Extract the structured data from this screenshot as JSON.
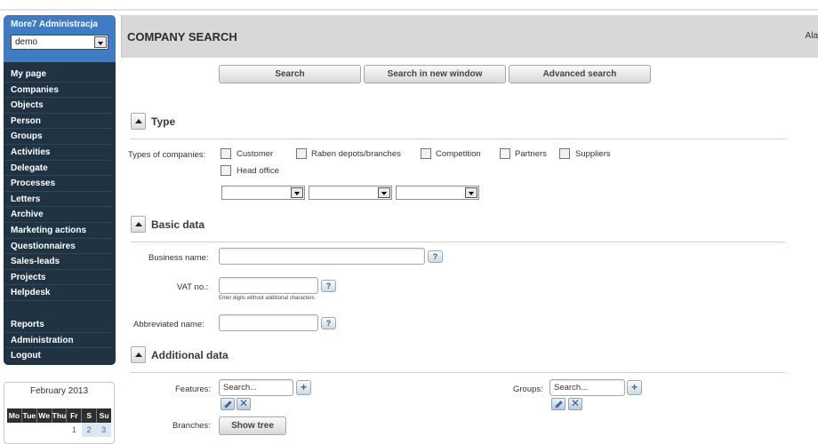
{
  "sidebar": {
    "brand_title": "More7 Administracja",
    "account_select": "demo",
    "menu": [
      "My page",
      "Companies",
      "Objects",
      "Person",
      "Groups",
      "Activities",
      "Delegate",
      "Processes",
      "Letters",
      "Archive",
      "Marketing actions",
      "Questionnaires",
      "Sales-leads",
      "Projects",
      "Helpdesk"
    ],
    "menu_bottom": [
      "Reports",
      "Administration",
      "Logout"
    ]
  },
  "calendar": {
    "title": "February 2013",
    "days": [
      "Mo",
      "Tue",
      "We",
      "Thu",
      "Fr",
      "S",
      "Su"
    ],
    "dates": [
      "",
      "",
      "",
      "",
      "1",
      "2",
      "3"
    ]
  },
  "header": {
    "title": "COMPANY SEARCH",
    "right_text": "Ala"
  },
  "actions": {
    "search": "Search",
    "search_new_window": "Search in new window",
    "advanced": "Advanced search"
  },
  "type_section": {
    "title": "Type",
    "types_label": "Types of companies:",
    "options": [
      "Customer",
      "Raben depots/branches",
      "Competition",
      "Partners",
      "Suppliers",
      "Head office"
    ]
  },
  "basic_section": {
    "title": "Basic data",
    "business_name_label": "Business name:",
    "vat_label": "VAT no.:",
    "vat_hint": "Enter digits without additional characters",
    "abbreviated_label": "Abbreviated name:",
    "help": "?"
  },
  "additional_section": {
    "title": "Additional data",
    "features_label": "Features:",
    "groups_label": "Groups:",
    "search_placeholder": "Search...",
    "branches_label": "Branches:",
    "show_tree": "Show tree",
    "plus": "+",
    "remove": "✕"
  }
}
